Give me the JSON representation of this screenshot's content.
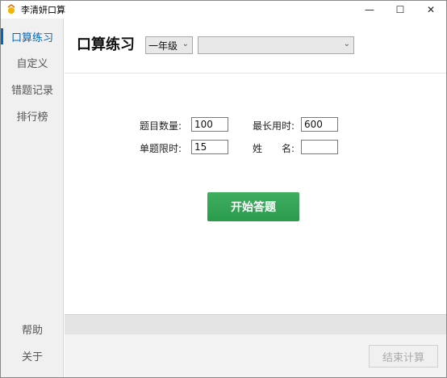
{
  "window": {
    "title": "李清妍口算",
    "minimize": "—",
    "maximize": "☐",
    "close": "✕"
  },
  "sidebar": {
    "items": [
      {
        "label": "口算练习"
      },
      {
        "label": "自定义"
      },
      {
        "label": "错题记录"
      },
      {
        "label": "排行榜"
      }
    ],
    "bottom_items": [
      {
        "label": "帮助"
      },
      {
        "label": "关于"
      }
    ]
  },
  "main": {
    "title": "口算练习",
    "grade_select": {
      "value": "一年级"
    },
    "topic_select": {
      "value": ""
    },
    "form": {
      "count_label": "题目数量:",
      "count_value": "100",
      "max_time_label": "最长用时:",
      "max_time_value": "600",
      "per_question_label": "单题限时:",
      "per_question_value": "15",
      "name_label": "姓　　名:",
      "name_value": ""
    },
    "start_button": "开始答题",
    "end_button": "结束计算"
  },
  "colors": {
    "accent": "#0067c0",
    "start_button": "#2fa553"
  }
}
